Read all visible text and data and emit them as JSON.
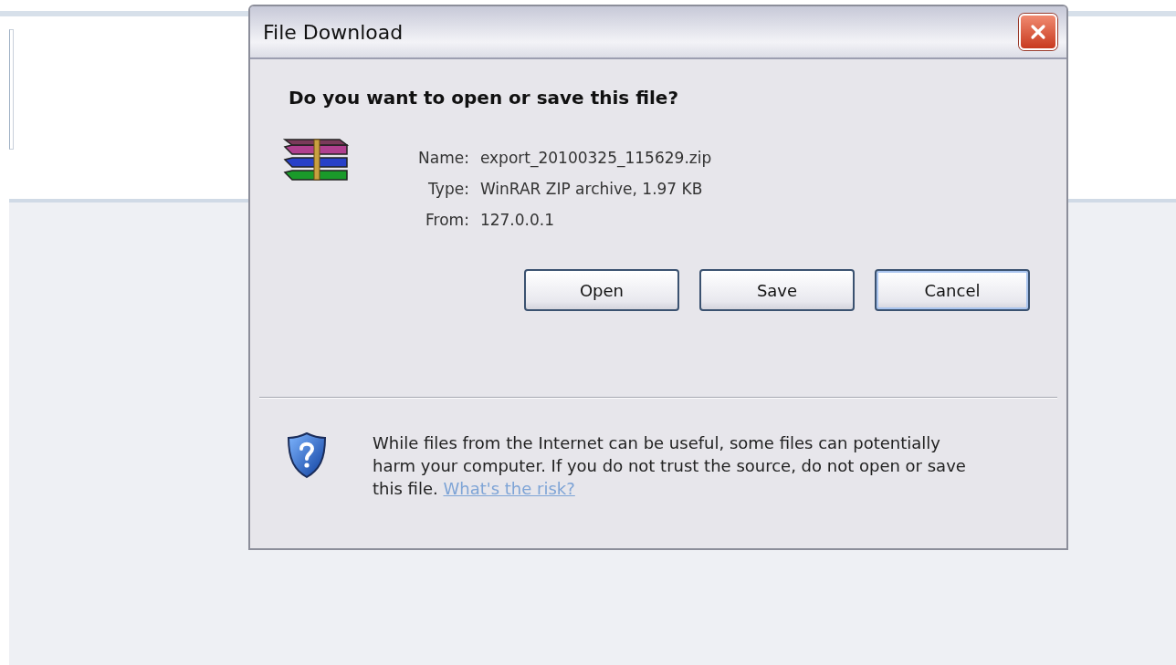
{
  "window": {
    "title": "File Download"
  },
  "question": "Do you want to open or save this file?",
  "details": [
    {
      "label": "Name:",
      "value": "export_20100325_115629.zip"
    },
    {
      "label": "Type:",
      "value": "WinRAR ZIP archive, 1.97 KB"
    },
    {
      "label": "From:",
      "value": "127.0.0.1"
    }
  ],
  "buttons": [
    {
      "label": "Open",
      "selected": false
    },
    {
      "label": "Save",
      "selected": false
    },
    {
      "label": "Cancel",
      "selected": true
    }
  ],
  "warning": {
    "text": "While files from the Internet can be useful, some files can potentially harm your computer. If you do not trust the source, do not open or save this file.",
    "link": "What's the risk?"
  }
}
